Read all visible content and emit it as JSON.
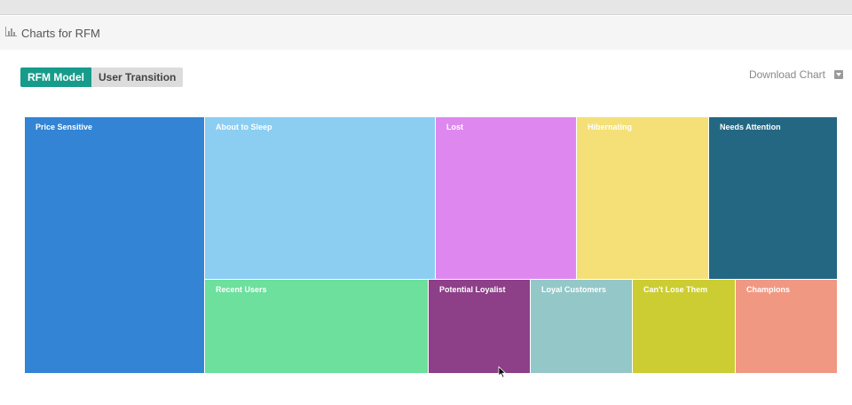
{
  "header": {
    "title": "Charts for RFM",
    "icon": "bar-chart-icon"
  },
  "tabs": [
    {
      "label": "RFM Model",
      "active": true
    },
    {
      "label": "User Transition",
      "active": false
    }
  ],
  "download": {
    "label": "Download Chart",
    "icon": "download-icon"
  },
  "chart_data": {
    "type": "treemap",
    "segments": [
      {
        "name": "Price Sensitive",
        "color": "#3384d4"
      },
      {
        "name": "About to Sleep",
        "color": "#8ccdf2"
      },
      {
        "name": "Lost",
        "color": "#de88ef"
      },
      {
        "name": "Hibernating",
        "color": "#f4e077"
      },
      {
        "name": "Needs Attention",
        "color": "#246782"
      },
      {
        "name": "Recent Users",
        "color": "#6ce09c"
      },
      {
        "name": "Potential Loyalist",
        "color": "#8d3f88"
      },
      {
        "name": "Loyal Customers",
        "color": "#94c7c8"
      },
      {
        "name": "Can't Lose Them",
        "color": "#cccd33"
      },
      {
        "name": "Champions",
        "color": "#f19883"
      }
    ]
  }
}
